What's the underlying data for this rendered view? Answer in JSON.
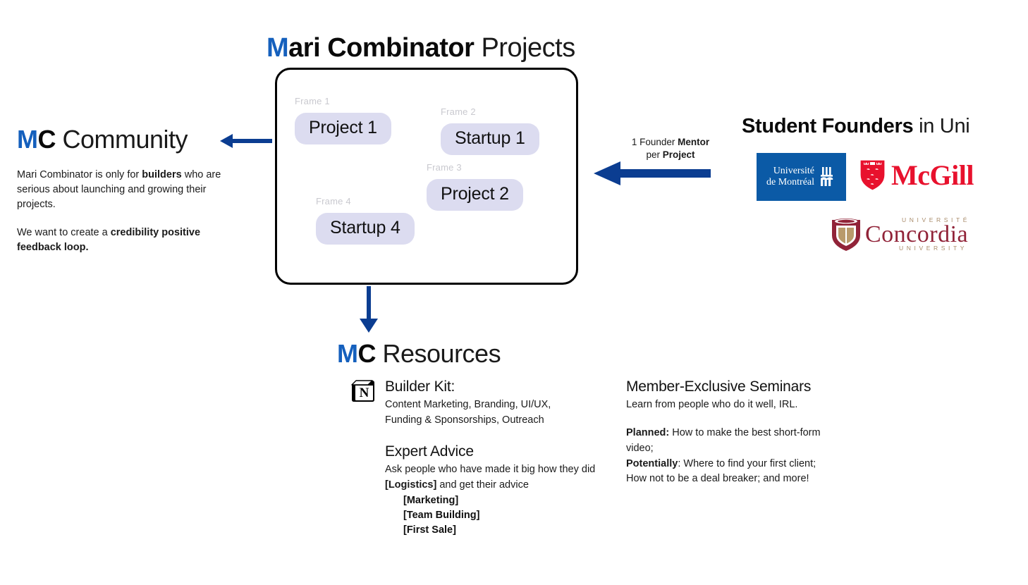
{
  "title": {
    "accent_letter": "M",
    "bold_part": "ari Combinator",
    "regular_part": " Projects"
  },
  "colors": {
    "accent_blue": "#1560bd",
    "arrow_blue": "#0b3d91",
    "pill_lavender": "#dcdcf0",
    "frame_label_gray": "#c9c9cf",
    "udem_blue": "#0b5aa6",
    "mcgill_red": "#e8112d",
    "concordia_maroon": "#912338",
    "concordia_tan": "#a98c6b"
  },
  "project_board": {
    "frames": [
      {
        "label": "Frame 1",
        "pill": "Project 1"
      },
      {
        "label": "Frame 2",
        "pill": "Startup 1"
      },
      {
        "label": "Frame 3",
        "pill": "Project 2"
      },
      {
        "label": "Frame 4",
        "pill": "Startup 4"
      }
    ]
  },
  "community": {
    "heading": {
      "accent_letter": "M",
      "bold_part": "C",
      "regular_part": " Community"
    },
    "paragraph_1": {
      "before": "Mari Combinator is only for ",
      "bold": "builders",
      "after": " who are serious about launching and growing their projects."
    },
    "paragraph_2": {
      "before": "We want to create a ",
      "bold": "credibility positive feedback loop."
    }
  },
  "mentor_arrow": {
    "line1_before": "1 Founder ",
    "line1_bold": "Mentor",
    "line2_before": "per ",
    "line2_bold": "Project"
  },
  "founders": {
    "heading_bold": "Student Founders",
    "heading_regular": " in Uni",
    "logos": [
      {
        "name": "Université de Montréal",
        "line1": "Université",
        "line2": "de Montréal"
      },
      {
        "name": "McGill",
        "wordmark": "McGill"
      },
      {
        "name": "Concordia University",
        "top": "UNIVERSITÉ",
        "main": "Concordia",
        "bottom": "UNIVERSITY"
      }
    ]
  },
  "resources": {
    "heading": {
      "accent_letter": "M",
      "bold_part": "C",
      "regular_part": " Resources"
    },
    "builder_kit": {
      "icon": "notion-icon",
      "title": "Builder Kit:",
      "body_line1": "Content Marketing, Branding, UI/UX,",
      "body_line2": "Funding & Sponsorships, Outreach"
    },
    "expert_advice": {
      "title": "Expert Advice",
      "body_before": "Ask people who have made it big how they did ",
      "body_bold": "[Logistics]",
      "body_after": " and get their advice",
      "items": [
        "[Marketing]",
        "[Team Building]",
        "[First Sale]"
      ]
    },
    "seminars": {
      "title": "Member-Exclusive Seminars",
      "subtitle": "Learn from people who do it well, IRL.",
      "planned_label": "Planned:",
      "planned_text": " How to make the best short-form video;",
      "potentially_label": "Potentially",
      "potentially_text": ": Where to find your first client; How not to be a deal breaker; and more!"
    }
  }
}
